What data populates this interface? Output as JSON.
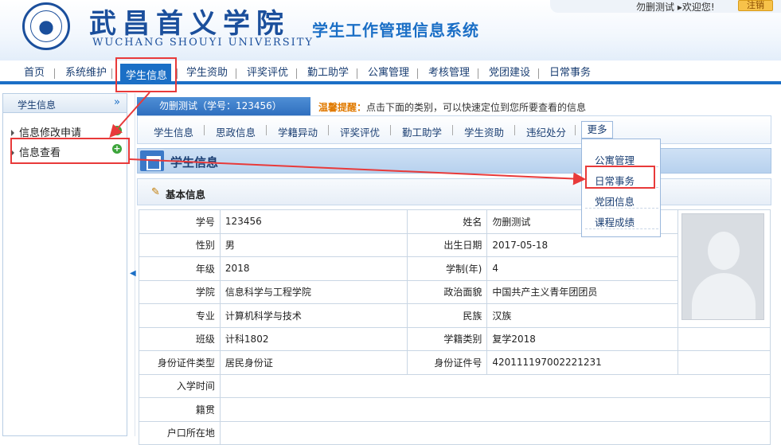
{
  "header": {
    "school_cn": "武昌首义学院",
    "school_en": "WUCHANG SHOUYI UNIVERSITY",
    "system_title": "学生工作管理信息系统",
    "user_greeting": "勿删测试 ▸欢迎您!",
    "logout_label": "注销"
  },
  "nav": {
    "items": [
      "首页",
      "系统维护",
      "学生信息",
      "学生资助",
      "评奖评优",
      "勤工助学",
      "公寓管理",
      "考核管理",
      "党团建设",
      "日常事务"
    ],
    "active": "学生信息"
  },
  "sidebar": {
    "title": "学生信息",
    "collapse_icon": "»",
    "items": [
      {
        "label": "信息修改申请"
      },
      {
        "label": "信息查看"
      }
    ]
  },
  "main": {
    "name_tab": "勿删测试（学号：123456）",
    "reminder_label": "温馨提醒：",
    "reminder_text": "点击下面的类别，可以快速定位到您所要查看的信息",
    "subnav": [
      "学生信息",
      "思政信息",
      "学籍异动",
      "评奖评优",
      "勤工助学",
      "学生资助",
      "违纪处分"
    ],
    "more_label": "更多",
    "more_menu": [
      "公寓管理",
      "日常事务",
      "党团信息",
      "课程成绩"
    ],
    "section_title": "学生信息",
    "basic_title": "基本信息"
  },
  "info": {
    "rows": [
      [
        "学号",
        "123456",
        "姓名",
        "勿删测试"
      ],
      [
        "性别",
        "男",
        "出生日期",
        "2017-05-18"
      ],
      [
        "年级",
        "2018",
        "学制(年)",
        "4"
      ],
      [
        "学院",
        "信息科学与工程学院",
        "政治面貌",
        "中国共产主义青年团团员"
      ],
      [
        "专业",
        "计算机科学与技术",
        "民族",
        "汉族"
      ],
      [
        "班级",
        "计科1802",
        "学籍类别",
        "复学2018"
      ],
      [
        "身份证件类型",
        "居民身份证",
        "身份证件号",
        "420111197002221231"
      ],
      [
        "入学时间",
        ""
      ],
      [
        "籍贯",
        ""
      ],
      [
        "户口所在地",
        ""
      ]
    ]
  },
  "colors": {
    "primary": "#1b6fc6",
    "annotation_red": "#e83a3a"
  }
}
